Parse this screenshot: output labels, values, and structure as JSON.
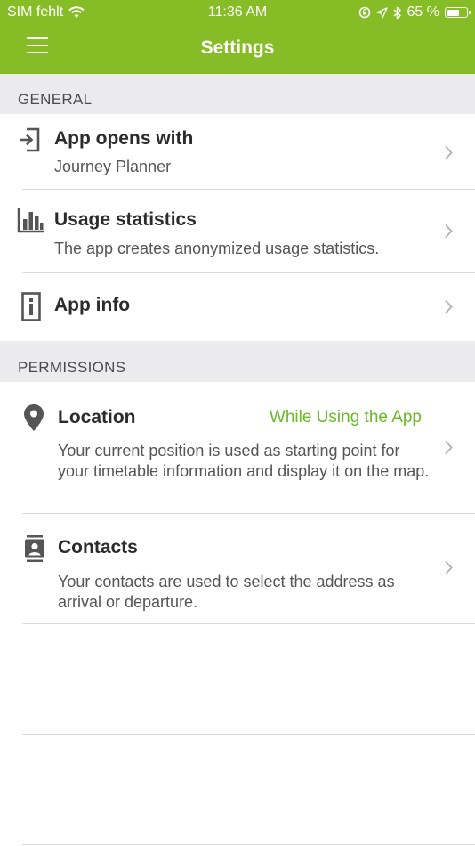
{
  "status_bar": {
    "carrier": "SIM fehlt",
    "time": "11:36 AM",
    "battery_percent": "65 %",
    "battery_level": 0.65
  },
  "nav": {
    "title": "Settings"
  },
  "sections": {
    "general": {
      "label": "GENERAL",
      "items": [
        {
          "title": "App opens with",
          "subtitle": "Journey Planner"
        },
        {
          "title": "Usage statistics",
          "subtitle": "The app creates anonymized usage statistics."
        },
        {
          "title": "App info"
        }
      ]
    },
    "permissions": {
      "label": "PERMISSIONS",
      "items": [
        {
          "title": "Location",
          "value": "While Using the App",
          "subtitle": "Your current position is used as starting point for your timetable information and display it on the map."
        },
        {
          "title": "Contacts",
          "subtitle": "Your contacts are used to select the address as arrival or departure."
        }
      ]
    }
  },
  "colors": {
    "brand": "#86bc25",
    "value_text": "#6ab827",
    "section_bg": "#ebebee"
  }
}
